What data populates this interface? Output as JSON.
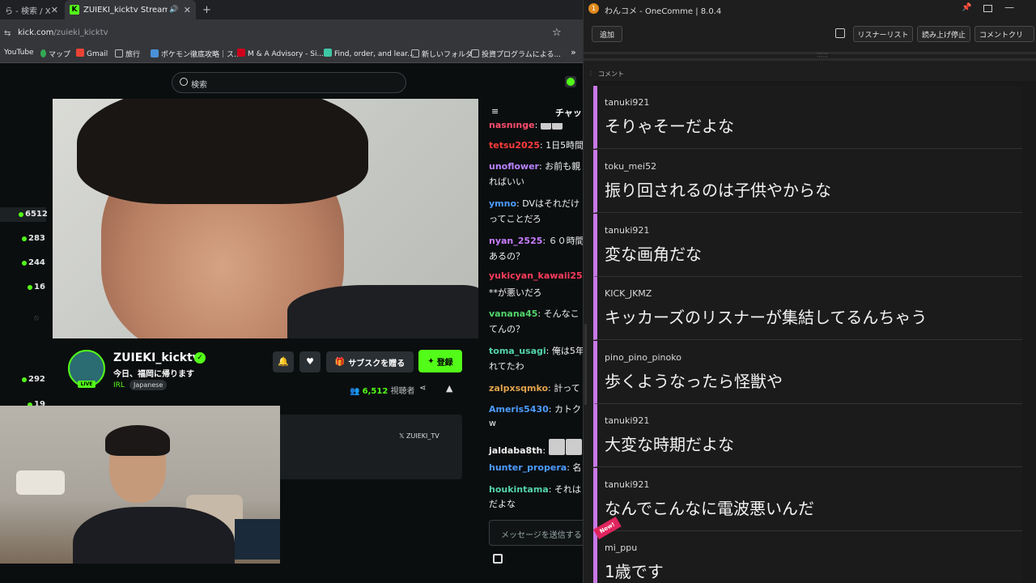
{
  "browser": {
    "tabs": [
      {
        "label": "ら - 検索 / X"
      },
      {
        "label": "ZUIEKI_kicktv Stream - Wat"
      }
    ],
    "url_host": "kick.com",
    "url_path": "/zuieki_kicktv",
    "bookmarks": [
      "YouTube",
      "マップ",
      "Gmail",
      "旅行",
      "ポケモン徹底攻略｜ス...",
      "M & A Advisory - Si...",
      "Find, order, and lear...",
      "新しいフォルダ",
      "投資プログラムによる..."
    ],
    "more_bookmarks": "»"
  },
  "kick": {
    "search_placeholder": "検索",
    "sidebar_viewers": [
      "6512",
      "283",
      "244",
      "16",
      "292",
      "19"
    ],
    "channel_name": "ZUIEKI_kicktv",
    "verified_mark": "✓",
    "stream_title": "今日、福岡に帰ります",
    "category": "IRL",
    "language": "Japanese",
    "live_label": "LIVE",
    "subscribe_label": "サブスクを贈る",
    "follow_label": "登録",
    "viewer_count": "6,512",
    "viewer_suffix": "視聴者",
    "x_handle": "ZUIEKI_TV",
    "chat_title": "チャッ",
    "chat_input_placeholder": "メッセージを送信する",
    "chat": [
      {
        "user": "hashinge",
        "color": "#ff4d6d",
        "text": ": "
      },
      {
        "user": "tetsu2025",
        "color": "#ff3b3b",
        "text": ": 1日5時間"
      },
      {
        "user": "unoflower",
        "color": "#b983ff",
        "text": ": お前も親",
        "cont": "ればいい"
      },
      {
        "user": "ymno",
        "color": "#4d9bff",
        "text": ": DVはそれだけ",
        "cont": "ってことだろ"
      },
      {
        "user": "nyan_2525",
        "color": "#c77dff",
        "text": ": ６０時間",
        "cont": "あるの？"
      },
      {
        "user": "yukicyan_kawaii25",
        "color": "#ff3b5c",
        "text": "",
        "cont": "**が悪いだろ"
      },
      {
        "user": "vanana45",
        "color": "#53d46b",
        "text": ": そんなこ",
        "cont": "てんの？"
      },
      {
        "user": "toma_usagi",
        "color": "#53d4a8",
        "text": ": 俺は5年",
        "cont": "れてたわ"
      },
      {
        "user": "zalpxsqmko",
        "color": "#e0a24d",
        "text": ": 計って"
      },
      {
        "user": "Ameris5430",
        "color": "#4d9bff",
        "text": ": カトク",
        "cont": "w"
      },
      {
        "user": "jaldaba8th",
        "color": "#f0f0f0",
        "text": ": "
      },
      {
        "user": "hunter_propera",
        "color": "#4d9bff",
        "text": ": 名"
      },
      {
        "user": "houkintama",
        "color": "#53d4a8",
        "text": ": それは",
        "cont": "だよな"
      }
    ]
  },
  "onecomme": {
    "app_title": "わんコメ - OneComme | 8.0.4",
    "add_label": "追加",
    "listener_list_label": "リスナーリスト",
    "stop_reading_label": "読み上げ停止",
    "comment_clear_label": "コメントクリ",
    "column_label": "コメント",
    "new_badge": "New!",
    "accent_color": "#c878e6",
    "comments": [
      {
        "user": "tanuki921",
        "message": "そりゃそーだよな"
      },
      {
        "user": "toku_mei52",
        "message": "振り回されるのは子供やからな"
      },
      {
        "user": "tanuki921",
        "message": "変な画角だな"
      },
      {
        "user": "KICK_JKMZ",
        "message": "キッカーズのリスナーが集結してるんちゃう"
      },
      {
        "user": "pino_pino_pinoko",
        "message": "歩くようなったら怪獣や"
      },
      {
        "user": "tanuki921",
        "message": "大変な時期だよな"
      },
      {
        "user": "tanuki921",
        "message": "なんでこんなに電波悪いんだ"
      },
      {
        "user": "mi_ppu",
        "message": "1歳です"
      }
    ]
  }
}
